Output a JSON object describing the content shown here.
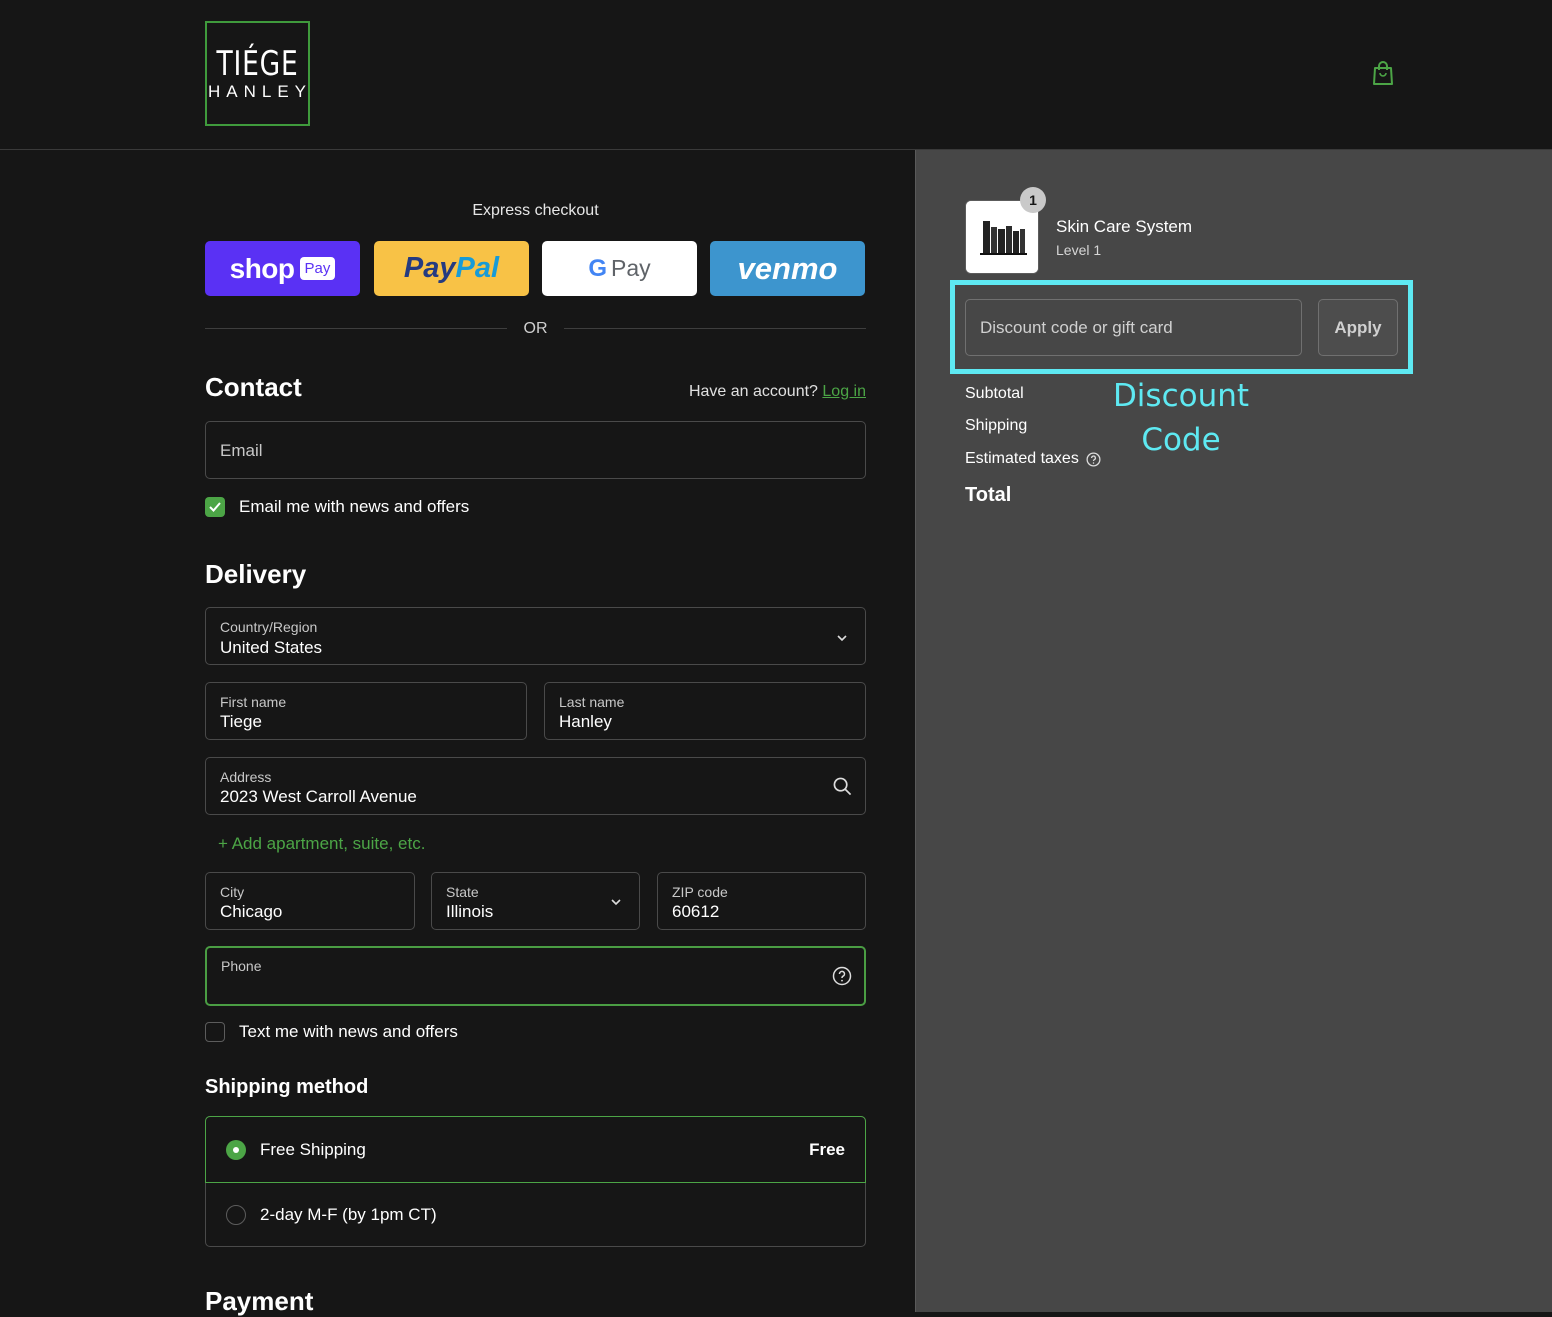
{
  "header": {
    "logo_line1": "TIÉGE",
    "logo_line2": "HANLEY",
    "accent_color": "#3f9a3c",
    "cart_icon": "shopping-bag-icon"
  },
  "express": {
    "title": "Express checkout",
    "shop_label": "shop",
    "shop_pay_label": "Pay",
    "paypal_label_a": "Pay",
    "paypal_label_b": "Pal",
    "gpay_g": "G",
    "gpay_label": "Pay",
    "venmo_label": "venmo",
    "or_label": "OR"
  },
  "contact": {
    "heading": "Contact",
    "account_prompt": "Have an account?",
    "login_link": "Log in",
    "email_placeholder": "Email",
    "news_checkbox_label": "Email me with news and offers",
    "news_checked": true
  },
  "delivery": {
    "heading": "Delivery",
    "country_label": "Country/Region",
    "country_value": "United States",
    "first_name_label": "First name",
    "first_name_value": "Tiege",
    "last_name_label": "Last name",
    "last_name_value": "Hanley",
    "address_label": "Address",
    "address_value": "2023 West Carroll Avenue",
    "add_apartment": "+ Add apartment, suite, etc.",
    "city_label": "City",
    "city_value": "Chicago",
    "state_label": "State",
    "state_value": "Illinois",
    "zip_label": "ZIP code",
    "zip_value": "60612",
    "phone_label": "Phone",
    "text_checkbox_label": "Text me with news and offers",
    "text_checked": false
  },
  "shipping": {
    "heading": "Shipping method",
    "options": [
      {
        "label": "Free Shipping",
        "price": "Free",
        "selected": true
      },
      {
        "label": "2-day M-F (by 1pm CT)",
        "price": "",
        "selected": false
      }
    ]
  },
  "payment": {
    "heading": "Payment"
  },
  "summary": {
    "product_name": "Skin Care System",
    "product_variant": "Level 1",
    "quantity": "1",
    "discount_placeholder": "Discount code or gift card",
    "apply_label": "Apply",
    "subtotal_label": "Subtotal",
    "shipping_label": "Shipping",
    "taxes_label": "Estimated taxes",
    "total_label": "Total",
    "annotation_line1": "Discount",
    "annotation_line2": "Code",
    "annotation_color": "#5ee9f2"
  }
}
